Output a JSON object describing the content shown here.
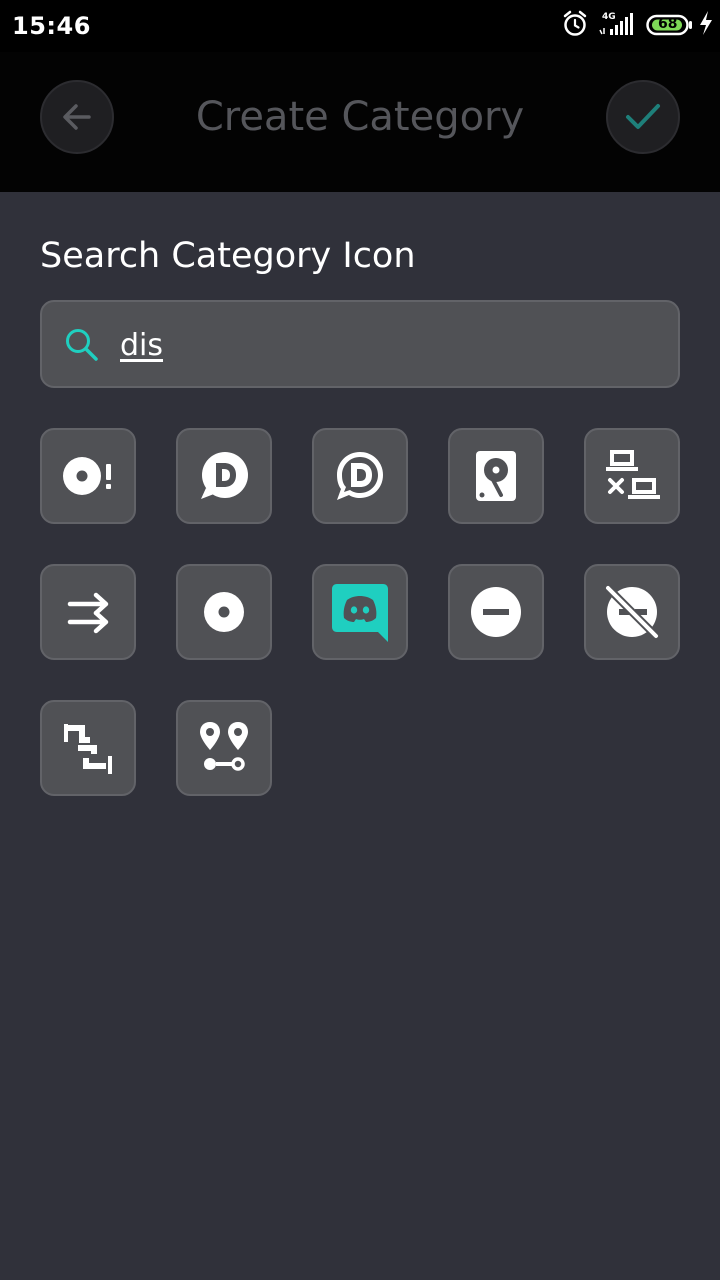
{
  "status_bar": {
    "time": "15:46",
    "network": "4G",
    "battery": "68"
  },
  "app_bar": {
    "title": "Create Category",
    "back_icon": "arrow-left-icon",
    "confirm_icon": "check-icon"
  },
  "search": {
    "label": "Search Category Icon",
    "value": "dis",
    "icon": "search-icon"
  },
  "icon_results": [
    {
      "name": "disc-alert-icon"
    },
    {
      "name": "deviantart-d-filled-icon"
    },
    {
      "name": "deviantart-d-outline-icon"
    },
    {
      "name": "harddisk-icon"
    },
    {
      "name": "lan-disconnect-icon"
    },
    {
      "name": "swap-horizontal-icon"
    },
    {
      "name": "disc-icon"
    },
    {
      "name": "discord-icon"
    },
    {
      "name": "minus-circle-icon"
    },
    {
      "name": "eye-off-circle-icon"
    },
    {
      "name": "pipe-disconnected-icon"
    },
    {
      "name": "map-marker-distance-icon"
    }
  ],
  "colors": {
    "accent": "#1fcfc0",
    "background": "#30313a",
    "tile": "#505155",
    "tile_border": "#626368",
    "app_bar": "#030303",
    "title_disabled": "#55565b",
    "confirm_check": "#1e7f7a",
    "battery_fill": "#7ed957"
  }
}
